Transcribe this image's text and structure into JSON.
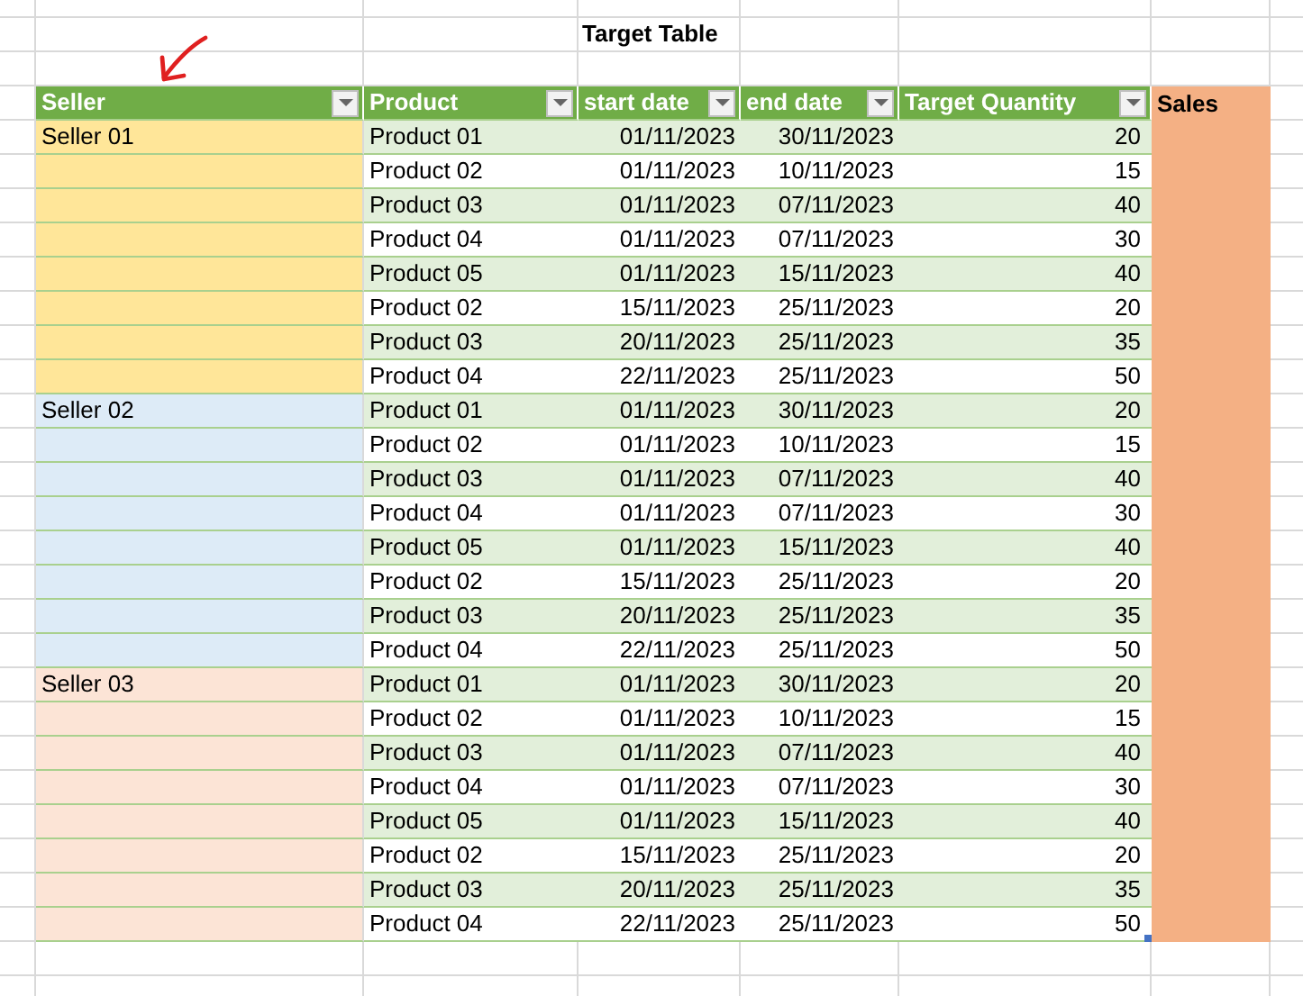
{
  "title": "Target Table",
  "columns": [
    {
      "label": "Seller",
      "kind": "table",
      "filter": true
    },
    {
      "label": "Product",
      "kind": "table",
      "filter": true
    },
    {
      "label": "start date",
      "kind": "table",
      "filter": true
    },
    {
      "label": "end date",
      "kind": "table",
      "filter": true
    },
    {
      "label": "Target Quantity",
      "kind": "table",
      "filter": true
    },
    {
      "label": "Sales",
      "kind": "highlight",
      "filter": false
    }
  ],
  "sellers": [
    {
      "name": "Seller 01",
      "color": "#ffe699",
      "rows": [
        {
          "product": "Product 01",
          "start_date": "01/11/2023",
          "end_date": "30/11/2023",
          "target_quantity": "20"
        },
        {
          "product": "Product 02",
          "start_date": "01/11/2023",
          "end_date": "10/11/2023",
          "target_quantity": "15"
        },
        {
          "product": "Product 03",
          "start_date": "01/11/2023",
          "end_date": "07/11/2023",
          "target_quantity": "40"
        },
        {
          "product": "Product 04",
          "start_date": "01/11/2023",
          "end_date": "07/11/2023",
          "target_quantity": "30"
        },
        {
          "product": "Product 05",
          "start_date": "01/11/2023",
          "end_date": "15/11/2023",
          "target_quantity": "40"
        },
        {
          "product": "Product 02",
          "start_date": "15/11/2023",
          "end_date": "25/11/2023",
          "target_quantity": "20"
        },
        {
          "product": "Product 03",
          "start_date": "20/11/2023",
          "end_date": "25/11/2023",
          "target_quantity": "35"
        },
        {
          "product": "Product 04",
          "start_date": "22/11/2023",
          "end_date": "25/11/2023",
          "target_quantity": "50"
        }
      ]
    },
    {
      "name": "Seller 02",
      "color": "#ddebf7",
      "rows": [
        {
          "product": "Product 01",
          "start_date": "01/11/2023",
          "end_date": "30/11/2023",
          "target_quantity": "20"
        },
        {
          "product": "Product 02",
          "start_date": "01/11/2023",
          "end_date": "10/11/2023",
          "target_quantity": "15"
        },
        {
          "product": "Product 03",
          "start_date": "01/11/2023",
          "end_date": "07/11/2023",
          "target_quantity": "40"
        },
        {
          "product": "Product 04",
          "start_date": "01/11/2023",
          "end_date": "07/11/2023",
          "target_quantity": "30"
        },
        {
          "product": "Product 05",
          "start_date": "01/11/2023",
          "end_date": "15/11/2023",
          "target_quantity": "40"
        },
        {
          "product": "Product 02",
          "start_date": "15/11/2023",
          "end_date": "25/11/2023",
          "target_quantity": "20"
        },
        {
          "product": "Product 03",
          "start_date": "20/11/2023",
          "end_date": "25/11/2023",
          "target_quantity": "35"
        },
        {
          "product": "Product 04",
          "start_date": "22/11/2023",
          "end_date": "25/11/2023",
          "target_quantity": "50"
        }
      ]
    },
    {
      "name": "Seller 03",
      "color": "#fce4d6",
      "rows": [
        {
          "product": "Product 01",
          "start_date": "01/11/2023",
          "end_date": "30/11/2023",
          "target_quantity": "20"
        },
        {
          "product": "Product 02",
          "start_date": "01/11/2023",
          "end_date": "10/11/2023",
          "target_quantity": "15"
        },
        {
          "product": "Product 03",
          "start_date": "01/11/2023",
          "end_date": "07/11/2023",
          "target_quantity": "40"
        },
        {
          "product": "Product 04",
          "start_date": "01/11/2023",
          "end_date": "07/11/2023",
          "target_quantity": "30"
        },
        {
          "product": "Product 05",
          "start_date": "01/11/2023",
          "end_date": "15/11/2023",
          "target_quantity": "40"
        },
        {
          "product": "Product 02",
          "start_date": "15/11/2023",
          "end_date": "25/11/2023",
          "target_quantity": "20"
        },
        {
          "product": "Product 03",
          "start_date": "20/11/2023",
          "end_date": "25/11/2023",
          "target_quantity": "35"
        },
        {
          "product": "Product 04",
          "start_date": "22/11/2023",
          "end_date": "25/11/2023",
          "target_quantity": "50"
        }
      ]
    }
  ]
}
